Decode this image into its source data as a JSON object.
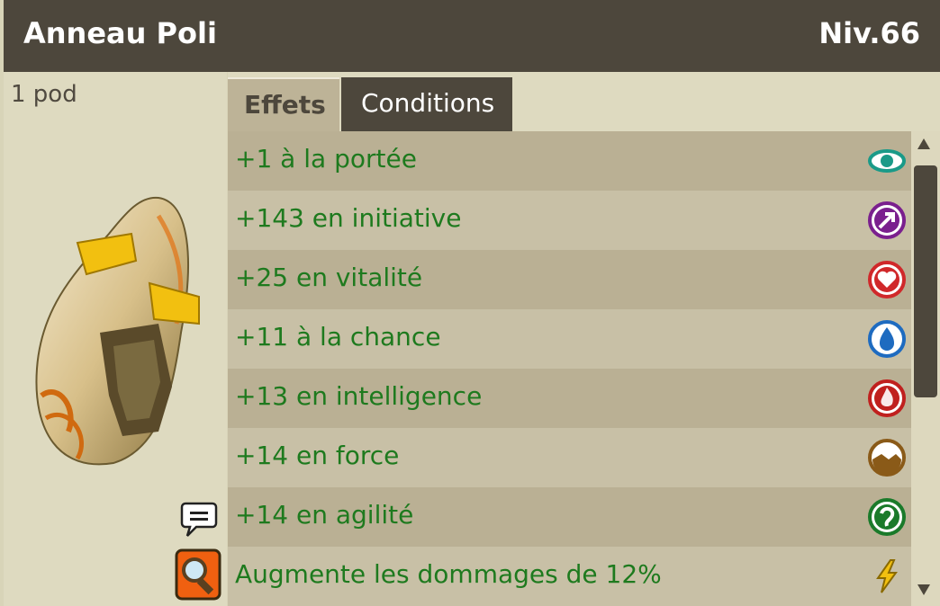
{
  "item": {
    "name": "Anneau Poli",
    "level": "Niv.66",
    "weight": "1 pod"
  },
  "tabs": [
    {
      "label": "Effets",
      "active": true
    },
    {
      "label": "Conditions",
      "active": false
    }
  ],
  "effects": [
    {
      "text": "+1 à la portée",
      "icon": "range-eye-icon",
      "color": "#1a9a88"
    },
    {
      "text": "+143 en initiative",
      "icon": "initiative-arrow-icon",
      "color": "#7a1f8e"
    },
    {
      "text": "+25 en vitalité",
      "icon": "vitality-heart-icon",
      "color": "#d0282a"
    },
    {
      "text": "+11 à la chance",
      "icon": "chance-water-icon",
      "color": "#1e6bc0"
    },
    {
      "text": "+13 en intelligence",
      "icon": "intelligence-fire-icon",
      "color": "#c0201e"
    },
    {
      "text": "+14 en force",
      "icon": "strength-earth-icon",
      "color": "#8a5a18"
    },
    {
      "text": "+14 en agilité",
      "icon": "agility-air-icon",
      "color": "#1a7a2a"
    },
    {
      "text": "Augmente les dommages de 12%",
      "icon": "damage-lightning-icon",
      "color": "#f2c010"
    }
  ],
  "colors": {
    "header": "#4d473c",
    "effect_text": "#1e7a1e",
    "panel": "#d8d4b8"
  }
}
